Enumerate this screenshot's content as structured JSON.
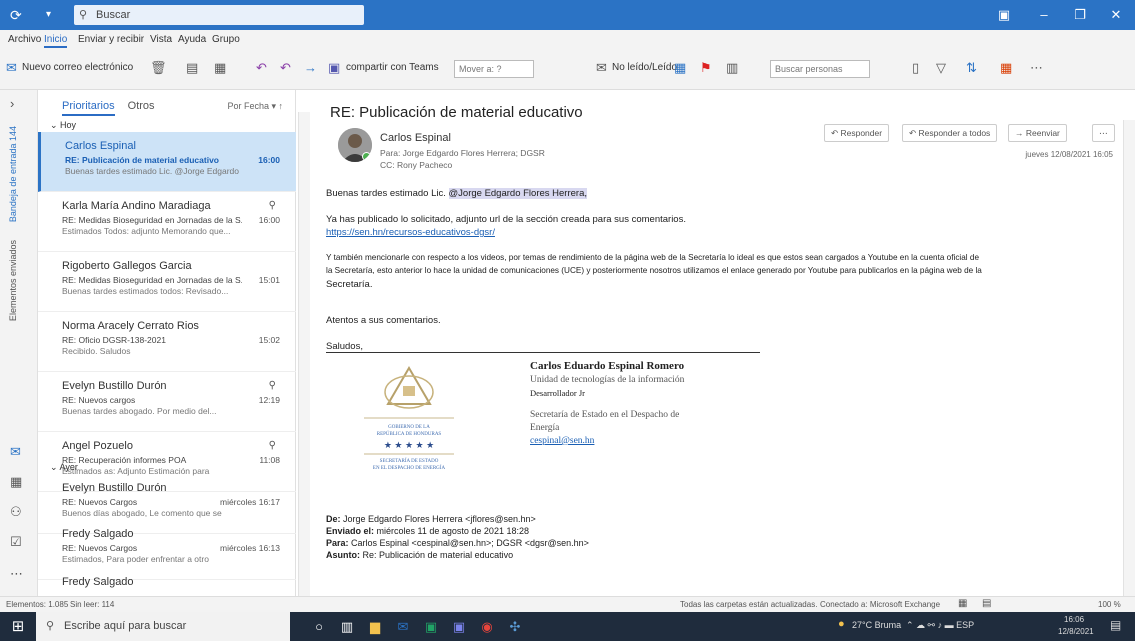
{
  "titlebar": {
    "search_placeholder": "Buscar"
  },
  "menu": [
    "Archivo",
    "Inicio",
    "Enviar y recibir",
    "Vista",
    "Ayuda",
    "Grupo"
  ],
  "ribbon": {
    "new_email": "Nuevo correo electrónico",
    "teams": "compartir con Teams",
    "move": "Mover a: ?",
    "unread": "No leído/Leído",
    "search_people": "Buscar personas"
  },
  "left_rail": {
    "folder_pane": "Bandeja de entrada 144",
    "favorites": "Elementos enviados"
  },
  "list": {
    "tab_focused": "Prioritarios",
    "tab_other": "Otros",
    "sort": "Por Fecha",
    "group_today": "Hoy",
    "group_yesterday": "Ayer",
    "messages": [
      {
        "from": "Carlos Espinal",
        "subject": "RE: Publicación de material educativo",
        "preview": "Buenas tardes estimado Lic. @Jorge Edgardo",
        "time": "16:00",
        "clip": ""
      },
      {
        "from": "Karla María Andino Maradiaga",
        "subject": "RE: Medidas Bioseguridad en Jornadas de la S...",
        "preview": "Estimados Todos: adjunto Memorando que...",
        "time": "16:00",
        "clip": "⚲"
      },
      {
        "from": "Rigoberto Gallegos Garcia",
        "subject": "RE: Medidas Bioseguridad en Jornadas de la S...",
        "preview": "Buenas tardes estimados todos: Revisado...",
        "time": "15:01",
        "clip": ""
      },
      {
        "from": "Norma Aracely Cerrato Rios",
        "subject": "RE: Oficio DGSR-138-2021",
        "preview": "Recibido. Saludos",
        "time": "15:02",
        "clip": ""
      },
      {
        "from": "Evelyn Bustillo Durón",
        "subject": "RE: Nuevos cargos",
        "preview": "Buenas tardes abogado. Por medio del...",
        "time": "12:19",
        "clip": "⚲"
      },
      {
        "from": "Angel Pozuelo",
        "subject": "RE: Recuperación informes POA",
        "preview": "Estimados as: Adjunto Estimación para",
        "time": "11:08",
        "clip": "⚲"
      },
      {
        "from": "Evelyn Bustillo Durón",
        "subject": "RE: Nuevos Cargos",
        "preview": "Buenos días abogado, Le comento que se",
        "time": "miércoles 16:17",
        "clip": ""
      },
      {
        "from": "Fredy Salgado",
        "subject": "RE: Nuevos Cargos",
        "preview": "Estimados, Para poder enfrentar a otro",
        "time": "miércoles 16:13",
        "clip": ""
      },
      {
        "from": "Fredy Salgado",
        "subject": "",
        "preview": "",
        "time": "",
        "clip": ""
      }
    ]
  },
  "reading": {
    "subject": "RE: Publicación de material educativo",
    "sender": "Carlos Espinal",
    "to": "Para: Jorge Edgardo Flores Herrera; DGSR",
    "cc": "CC: Rony Pacheco",
    "reply": "Responder",
    "reply_all": "Responder a todos",
    "forward": "Reenviar",
    "date": "jueves 12/08/2021 16:05",
    "greeting_prefix": "Buenas tardes estimado Lic.",
    "greeting_mention": "@Jorge Edgardo Flores Herrera,",
    "p1": "Ya has publicado lo solicitado, adjunto url de la sección creada para sus comentarios.",
    "link": "https://sen.hn/recursos-educativos-dgsr/",
    "p2a": "Y también mencionarle con respecto a los videos, por temas de rendimiento de la página web de la Secretaría lo ideal es que estos sean cargados a Youtube en la cuenta oficial de",
    "p2b": "la Secretaría, esto anterior lo hace la unidad de comunicaciones (UCE) y posteriormente nosotros utilizamos el enlace generado por Youtube para publicarlos en la página web de la",
    "p2c": "Secretaría.",
    "p3": "Atentos a sus comentarios.",
    "closing": "Saludos,",
    "sig_name": "Carlos Eduardo Espinal Romero",
    "sig_unit": "Unidad de tecnologías de la información",
    "sig_role": "Desarrollador Jr",
    "sig_org1": "Secretaría de Estado en el Despacho de",
    "sig_org2": "Energía",
    "sig_email": "cespinal@sen.hn",
    "seal_line1": "GOBIERNO DE LA",
    "seal_line2": "REPÚBLICA DE HONDURAS",
    "seal_line3": "SECRETARÍA DE ESTADO",
    "seal_line4": "EN EL DESPACHO DE ENERGÍA",
    "q_from_label": "De:",
    "q_from": "Jorge Edgardo Flores Herrera <jflores@sen.hn>",
    "q_sent_label": "Enviado el:",
    "q_sent": "miércoles 11 de agosto de 2021 18:28",
    "q_to_label": "Para:",
    "q_to": "Carlos Espinal <cespinal@sen.hn>; DGSR <dgsr@sen.hn>",
    "q_subject_label": "Asunto:",
    "q_subject": "Re: Publicación de material educativo"
  },
  "status": {
    "items": "Elementos: 1.085",
    "unread": "Sin leer: 114",
    "sync": "Todas las carpetas están actualizadas.",
    "connected": "Conectado a: Microsoft Exchange",
    "zoom": "100 %"
  },
  "taskbar": {
    "search": "Escribe aquí para buscar",
    "weather": "27°C Bruma",
    "time": "16:06",
    "date": "12/8/2021"
  },
  "colors": {
    "accent": "#2b73c5",
    "selected": "#cde3f7",
    "taskbar": "#1f2c3d"
  }
}
